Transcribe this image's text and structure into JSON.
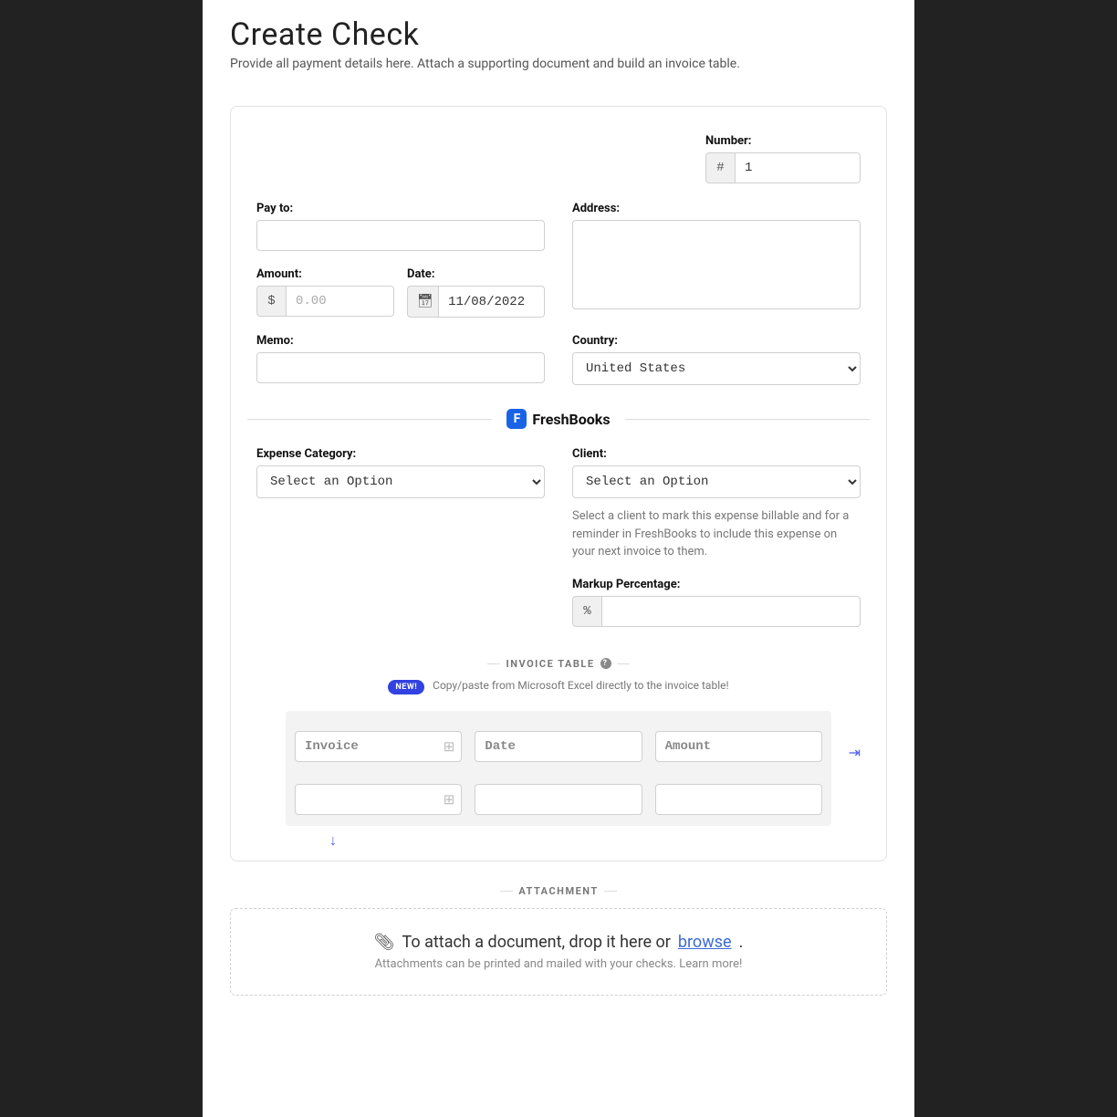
{
  "header": {
    "title": "Create Check",
    "subtitle": "Provide all payment details here. Attach a supporting document and build an invoice table."
  },
  "form": {
    "number_label": "Number:",
    "number_prefix": "#",
    "number_value": "1",
    "payto_label": "Pay to:",
    "payto_value": "",
    "address_label": "Address:",
    "address_value": "",
    "amount_label": "Amount:",
    "amount_prefix": "$",
    "amount_placeholder": "0.00",
    "amount_value": "",
    "date_label": "Date:",
    "date_value": "11/08/2022",
    "memo_label": "Memo:",
    "memo_value": "",
    "country_label": "Country:",
    "country_value": "United States"
  },
  "freshbooks": {
    "brand": "FreshBooks",
    "expense_label": "Expense Category:",
    "expense_value": "Select an Option",
    "client_label": "Client:",
    "client_value": "Select an Option",
    "client_help": "Select a client to mark this expense billable and for a reminder in FreshBooks to include this expense on your next invoice to them.",
    "markup_label": "Markup Percentage:",
    "markup_prefix": "%",
    "markup_value": ""
  },
  "invoice_table": {
    "heading": "INVOICE TABLE",
    "new_badge": "NEW!",
    "copy_hint": "Copy/paste from Microsoft Excel directly to the invoice table!",
    "hdr_invoice": "Invoice",
    "hdr_date": "Date",
    "hdr_amount": "Amount"
  },
  "attachment": {
    "heading": "ATTACHMENT",
    "line1_pre": "To attach a document, drop it here or ",
    "browse": "browse",
    "line1_post": ".",
    "line2": "Attachments can be printed and mailed with your checks. Learn more!"
  }
}
